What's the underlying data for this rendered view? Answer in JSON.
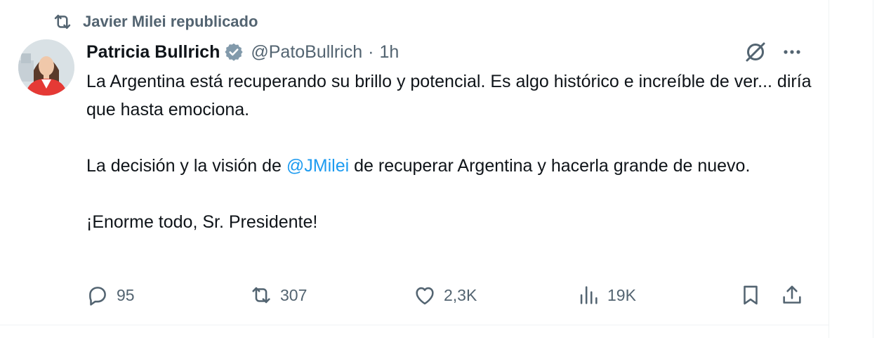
{
  "repost_header": {
    "text": "Javier Milei republicado",
    "icon": "repost-icon"
  },
  "author": {
    "name": "Patricia Bullrich",
    "verified": true,
    "handle": "@PatoBullrich",
    "separator": "·",
    "time": "1h"
  },
  "tweet": {
    "line1": "La Argentina está recuperando su brillo y potencial. Es algo histórico e increíble de ver... diría que hasta emociona.",
    "para2_before": "La decisión y la visión de ",
    "para2_mention": "@JMilei",
    "para2_after": " de recuperar Argentina y hacerla grande de nuevo.",
    "para3": "¡Enorme todo, Sr. Presidente!"
  },
  "actions": {
    "replies": "95",
    "reposts": "307",
    "likes": "2,3K",
    "views": "19K"
  },
  "colors": {
    "accent": "#1d9bf0",
    "secondary_text": "#536471",
    "verified": "#829aab"
  }
}
